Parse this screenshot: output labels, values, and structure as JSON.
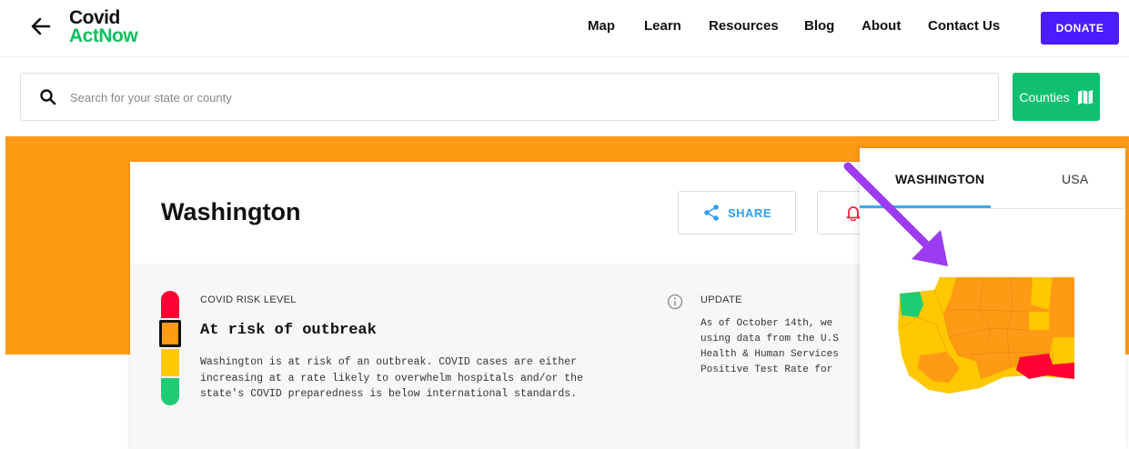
{
  "header": {
    "logo_line1": "Covid",
    "logo_line2": "ActNow",
    "nav": [
      "Map",
      "Learn",
      "Resources",
      "Blog",
      "About",
      "Contact Us"
    ],
    "donate_label": "DONATE"
  },
  "search": {
    "placeholder": "Search for your state or county",
    "value": ""
  },
  "counties_label": "Counties",
  "card": {
    "title": "Washington",
    "share_label": "SHARE",
    "risk": {
      "label": "COVID RISK LEVEL",
      "level": "At risk of outbreak",
      "description": "Washington is at risk of an outbreak. COVID cases are either increasing at a rate likely to overwhelm hospitals and/or the state's COVID preparedness is below international standards.",
      "levels": [
        "red",
        "orange",
        "yellow",
        "green"
      ],
      "selected_level": "orange"
    },
    "update": {
      "label": "UPDATE",
      "text": "As of October 14th, we\nusing data from the U.S\nHealth & Human Services\nPositive Test Rate for "
    }
  },
  "panel": {
    "tabs": [
      "WASHINGTON",
      "USA"
    ],
    "active_tab": "WASHINGTON"
  },
  "colors": {
    "brand_green": "#10c060",
    "donate": "#4a1cff",
    "orange": "#ff9a15",
    "red": "#ff0033",
    "yellow": "#ffc800",
    "green": "#1fcc74",
    "share_blue": "#2e9ff5",
    "annotation_arrow": "#9b3cf0"
  }
}
